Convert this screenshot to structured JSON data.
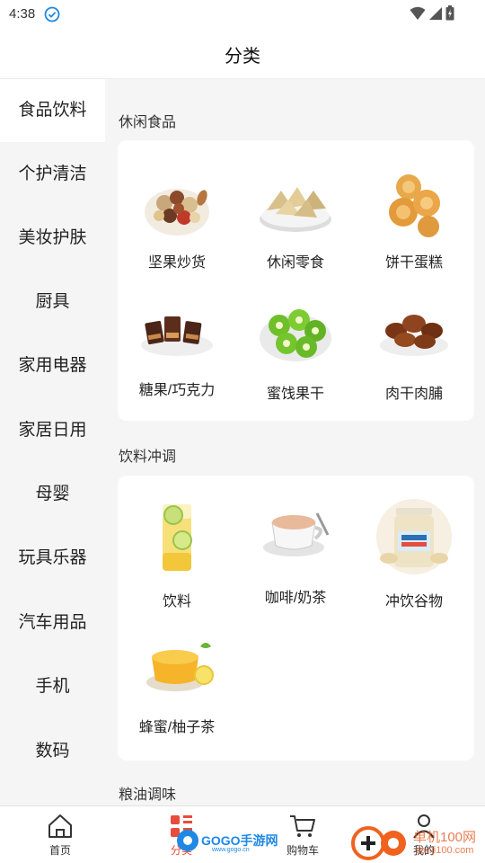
{
  "status_bar": {
    "time": "4:38"
  },
  "header": {
    "title": "分类"
  },
  "sidebar": {
    "items": [
      {
        "label": "食品饮料"
      },
      {
        "label": "个护清洁"
      },
      {
        "label": "美妆护肤"
      },
      {
        "label": "厨具"
      },
      {
        "label": "家用电器"
      },
      {
        "label": "家居日用"
      },
      {
        "label": "母婴"
      },
      {
        "label": "玩具乐器"
      },
      {
        "label": "汽车用品"
      },
      {
        "label": "手机"
      },
      {
        "label": "数码"
      }
    ]
  },
  "sections": [
    {
      "title": "休闲食品",
      "products": [
        {
          "label": "坚果炒货",
          "icon": "nuts-image"
        },
        {
          "label": "休闲零食",
          "icon": "chips-image"
        },
        {
          "label": "饼干蛋糕",
          "icon": "cookies-image"
        },
        {
          "label": "糖果/巧克力",
          "icon": "chocolate-image"
        },
        {
          "label": "蜜饯果干",
          "icon": "dried-kiwi-image"
        },
        {
          "label": "肉干肉脯",
          "icon": "jerky-image"
        }
      ]
    },
    {
      "title": "饮料冲调",
      "products": [
        {
          "label": "饮料",
          "icon": "lemonade-image"
        },
        {
          "label": "咖啡/奶茶",
          "icon": "milk-tea-image"
        },
        {
          "label": "冲饮谷物",
          "icon": "oats-jar-image"
        },
        {
          "label": "蜂蜜/柚子茶",
          "icon": "honey-citron-image"
        }
      ]
    },
    {
      "title": "粮油调味"
    }
  ],
  "bottom_nav": {
    "items": [
      {
        "label": "首页",
        "icon": "home-icon"
      },
      {
        "label": "分类",
        "icon": "category-icon"
      },
      {
        "label": "购物车",
        "icon": "cart-icon"
      },
      {
        "label": "我的",
        "icon": "user-icon"
      }
    ]
  },
  "watermark": {
    "left_text": "GOGO手游网",
    "left_url": "www.gogo.cn",
    "right_text": "单机100网",
    "right_url": "danji100.com"
  },
  "colors": {
    "accent_blue": "#1e88e5",
    "sidebar_bg": "#f5f5f5",
    "active_bg": "#ffffff",
    "watermark_orange": "#f0621e"
  }
}
